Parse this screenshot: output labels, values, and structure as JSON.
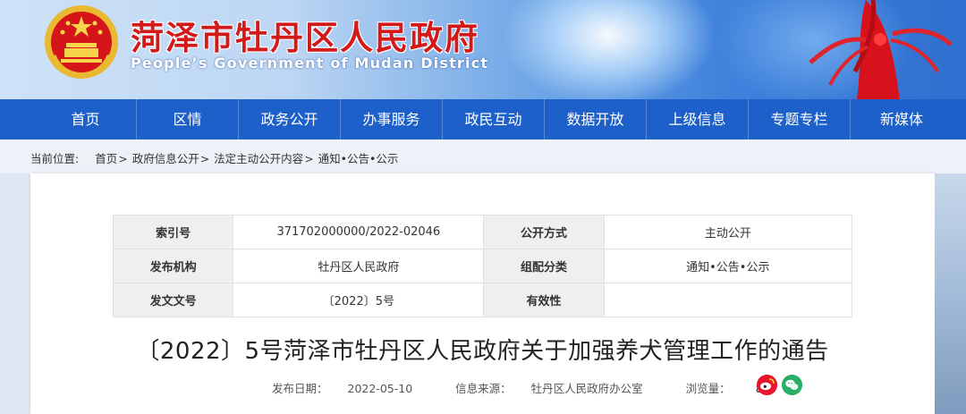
{
  "header": {
    "title": "菏泽市牡丹区人民政府",
    "subtitle": "People’s Government of Mudan District",
    "emblem_icon": "national-emblem-icon",
    "colors": {
      "title_red": "#d21a1a",
      "nav_blue": "#1e60c9"
    }
  },
  "nav": {
    "items": [
      "首页",
      "区情",
      "政务公开",
      "办事服务",
      "政民互动",
      "数据开放",
      "上级信息",
      "专题专栏",
      "新媒体"
    ]
  },
  "breadcrumb": {
    "label": "当前位置:",
    "items": [
      "首页",
      "政府信息公开",
      "法定主动公开内容",
      "通知•公告•公示"
    ],
    "separator": ">"
  },
  "meta": {
    "rows": [
      {
        "k1": "索引号",
        "v1": "371702000000/2022-02046",
        "k2": "公开方式",
        "v2": "主动公开"
      },
      {
        "k1": "发布机构",
        "v1": "牡丹区人民政府",
        "k2": "组配分类",
        "v2": "通知•公告•公示"
      },
      {
        "k1": "发文文号",
        "v1": "〔2022〕5号",
        "k2": "有效性",
        "v2": ""
      }
    ]
  },
  "article": {
    "title": "〔2022〕5号菏泽市牡丹区人民政府关于加强养犬管理工作的通告",
    "date_label": "发布日期：",
    "date": "2022-05-10",
    "source_label": "信息来源：",
    "source": "牡丹区人民政府办公室",
    "views_label": "浏览量：",
    "views": "81"
  },
  "share": {
    "icons": [
      "weibo-icon",
      "wechat-icon"
    ]
  }
}
